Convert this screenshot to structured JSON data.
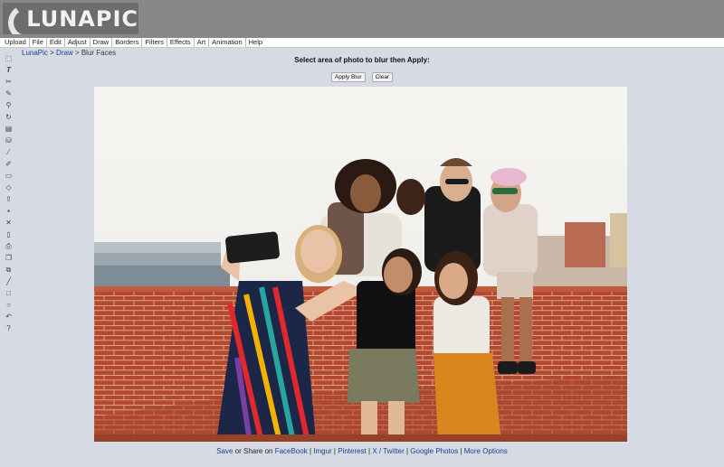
{
  "app": {
    "logo_text": "LUNAPIC"
  },
  "menu": [
    "Upload",
    "File",
    "Edit",
    "Adjust",
    "Draw",
    "Borders",
    "Filters",
    "Effects",
    "Art",
    "Animation",
    "Help"
  ],
  "breadcrumb": {
    "root": "LunaPic",
    "sep": " > ",
    "parent": "Draw",
    "current": "Blur Faces"
  },
  "instructions": "Select area of photo to blur then Apply:",
  "buttons": {
    "apply": "Apply Blur",
    "clear": "Clear"
  },
  "toolbar": [
    "select-icon",
    "text-icon",
    "scissors-icon",
    "pencil-icon",
    "zoom-icon",
    "rotate-icon",
    "crop-icon",
    "fill-bucket-icon",
    "eyedropper-icon",
    "brush-icon",
    "open-folder-icon",
    "eraser-icon",
    "upload-icon",
    "save-icon",
    "close-icon",
    "new-page-icon",
    "print-icon",
    "layers-icon",
    "copy-icon",
    "line-icon",
    "rectangle-icon",
    "circle-icon",
    "undo-icon",
    "help-icon"
  ],
  "share": {
    "save": "Save",
    "or_share": " or Share on ",
    "links": [
      "FaceBook",
      "Imgur",
      "Pinterest",
      "X / Twitter",
      "Google Photos",
      "More Options"
    ],
    "sep": " | "
  }
}
